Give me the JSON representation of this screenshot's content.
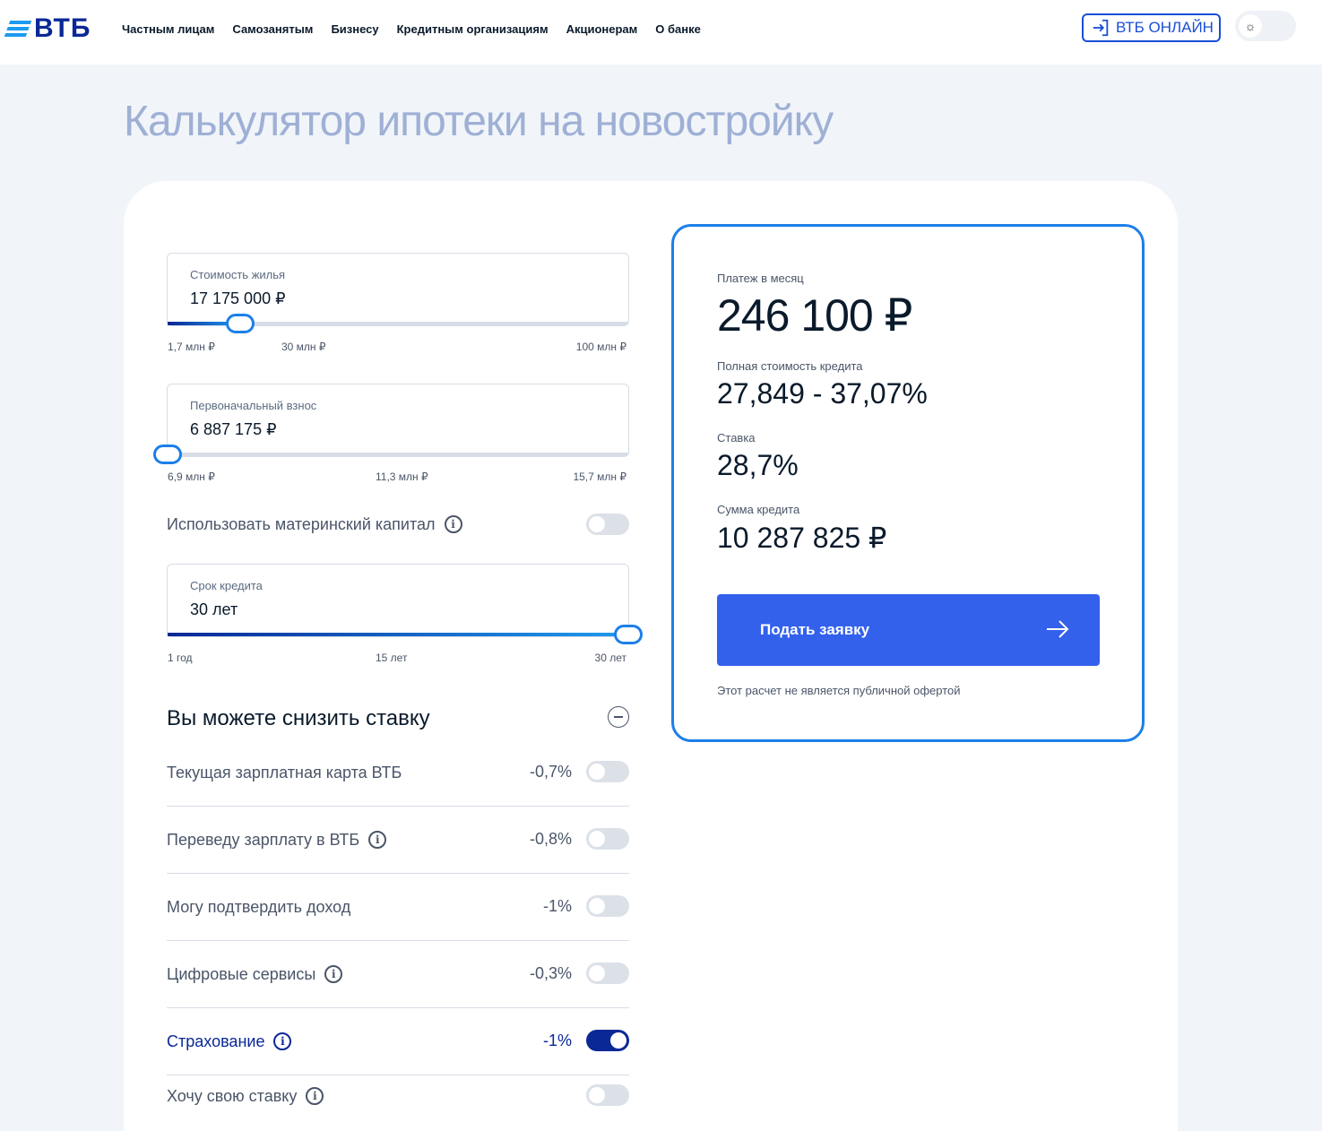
{
  "header": {
    "logo": "ВТБ",
    "nav": [
      "Частным лицам",
      "Самозанятым",
      "Бизнесу",
      "Кредитным организациям",
      "Акционерам",
      "О банке"
    ],
    "online_label": "ВТБ ОНЛАЙН",
    "theme_icon": "sun-icon"
  },
  "page_title": "Калькулятор ипотеки на новостройку",
  "inputs": {
    "price": {
      "label": "Стоимость жилья",
      "value": "17 175 000 ₽",
      "slider_fraction": 0.158,
      "scale": [
        "1,7 млн ₽",
        "30 млн ₽",
        "100 млн ₽"
      ]
    },
    "down": {
      "label": "Первоначальный взнос",
      "value": "6 887 175 ₽",
      "slider_fraction": 0.0,
      "scale": [
        "6,9 млн ₽",
        "11,3 млн ₽",
        "15,7 млн ₽"
      ]
    },
    "maternal": {
      "label": "Использовать материнский капитал",
      "on": false
    },
    "term": {
      "label": "Срок кредита",
      "value": "30 лет",
      "slider_fraction": 1.0,
      "scale": [
        "1 год",
        "15 лет",
        "30 лет"
      ]
    }
  },
  "discounts": {
    "title": "Вы можете снизить ставку",
    "items": [
      {
        "label": "Текущая зарплатная карта ВТБ",
        "value": "-0,7%",
        "on": false,
        "info": false
      },
      {
        "label": "Переведу зарплату в ВТБ",
        "value": "-0,8%",
        "on": false,
        "info": true
      },
      {
        "label": "Могу подтвердить доход",
        "value": "-1%",
        "on": false,
        "info": false
      },
      {
        "label": "Цифровые сервисы",
        "value": "-0,3%",
        "on": false,
        "info": true
      },
      {
        "label": "Страхование",
        "value": "-1%",
        "on": true,
        "info": true
      },
      {
        "label": "Хочу свою ставку",
        "value": "",
        "on": false,
        "info": true
      }
    ]
  },
  "results": {
    "payment_label": "Платеж в месяц",
    "payment_value": "246 100 ₽",
    "full_cost_label": "Полная стоимость кредита",
    "full_cost_value": "27,849 - 37,07%",
    "rate_label": "Ставка",
    "rate_value": "28,7%",
    "sum_label": "Сумма кредита",
    "sum_value": "10 287 825 ₽",
    "apply_label": "Подать заявку",
    "disclaimer": "Этот расчет не является публичной офертой"
  },
  "colors": {
    "brand": "#0a2896",
    "accent": "#1d7fe8",
    "button": "#3361ec"
  }
}
